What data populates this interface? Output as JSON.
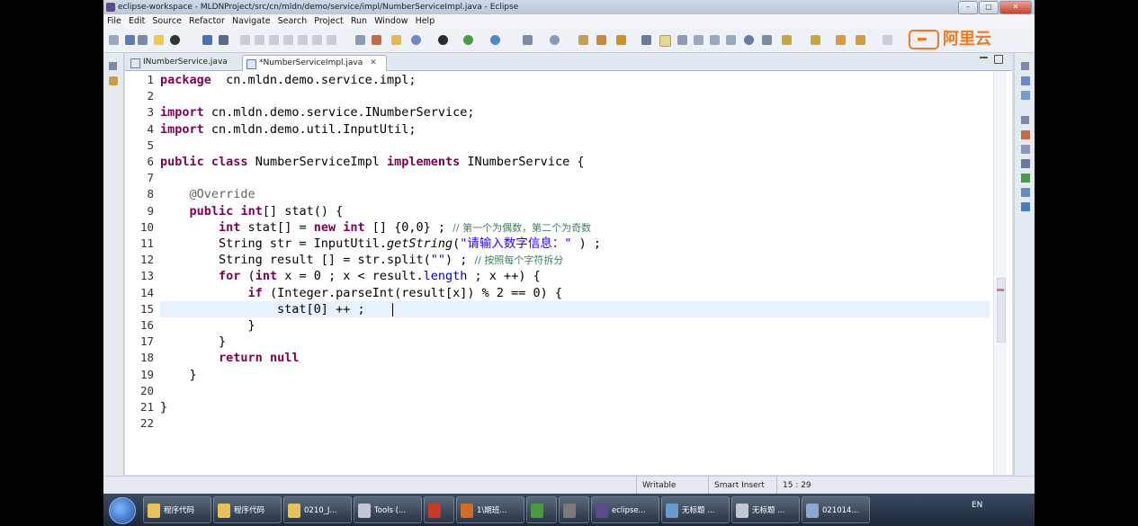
{
  "window": {
    "title": "eclipse-workspace - MLDNProject/src/cn/mldn/demo/service/impl/NumberServiceImpl.java - Eclipse",
    "min": "–",
    "max": "□",
    "close": "✕"
  },
  "menu": [
    "File",
    "Edit",
    "Source",
    "Refactor",
    "Navigate",
    "Search",
    "Project",
    "Run",
    "Window",
    "Help"
  ],
  "logo": {
    "text": "阿里云",
    "accent": "#f07a1f"
  },
  "tabs": [
    {
      "label": "INumberService.java",
      "active": false
    },
    {
      "label": "*NumberServiceImpl.java",
      "active": true
    }
  ],
  "editor": {
    "current_line": 15,
    "lines": [
      {
        "n": "1",
        "segs": [
          [
            "kw",
            "package"
          ],
          [
            "",
            "  cn.mldn.demo.service.impl;"
          ]
        ]
      },
      {
        "n": "2",
        "segs": []
      },
      {
        "n": "3",
        "segs": [
          [
            "kw",
            "import"
          ],
          [
            "",
            " cn.mldn.demo.service.INumberService;"
          ]
        ]
      },
      {
        "n": "4",
        "segs": [
          [
            "kw",
            "import"
          ],
          [
            "",
            " cn.mldn.demo.util.InputUtil;"
          ]
        ]
      },
      {
        "n": "5",
        "segs": []
      },
      {
        "n": "6",
        "segs": [
          [
            "kw",
            "public"
          ],
          [
            "",
            " "
          ],
          [
            "kw",
            "class"
          ],
          [
            "",
            " NumberServiceImpl "
          ],
          [
            "kw",
            "implements"
          ],
          [
            "",
            " INumberService {"
          ]
        ]
      },
      {
        "n": "7",
        "segs": []
      },
      {
        "n": "8",
        "segs": [
          [
            "",
            "    "
          ],
          [
            "ann",
            "@Override"
          ]
        ]
      },
      {
        "n": "9",
        "segs": [
          [
            "",
            "    "
          ],
          [
            "kw",
            "public"
          ],
          [
            "",
            " "
          ],
          [
            "kw",
            "int"
          ],
          [
            "",
            "[] stat() {"
          ]
        ]
      },
      {
        "n": "10",
        "segs": [
          [
            "",
            "        "
          ],
          [
            "kw",
            "int"
          ],
          [
            "",
            " stat[] = "
          ],
          [
            "kw",
            "new"
          ],
          [
            "",
            " "
          ],
          [
            "kw",
            "int"
          ],
          [
            "",
            " [] {0,0} ; "
          ],
          [
            "cm",
            "// 第一个为偶数，第二个为奇数"
          ]
        ]
      },
      {
        "n": "11",
        "segs": [
          [
            "",
            "        String str = InputUtil."
          ],
          [
            "it",
            "getString"
          ],
          [
            "",
            "("
          ],
          [
            "str",
            "\"请输入数字信息：\""
          ],
          [
            "",
            " ) ;"
          ]
        ]
      },
      {
        "n": "12",
        "segs": [
          [
            "",
            "        String result [] = str.split("
          ],
          [
            "str",
            "\"\""
          ],
          [
            "",
            ") ; "
          ],
          [
            "cm",
            "// 按照每个字符拆分"
          ]
        ]
      },
      {
        "n": "13",
        "segs": [
          [
            "",
            "        "
          ],
          [
            "kw",
            "for"
          ],
          [
            "",
            " ("
          ],
          [
            "kw",
            "int"
          ],
          [
            "",
            " x = 0 ; x < result."
          ],
          [
            "fld",
            "length"
          ],
          [
            "",
            " ; x ++) {"
          ]
        ]
      },
      {
        "n": "14",
        "segs": [
          [
            "",
            "            "
          ],
          [
            "kw",
            "if"
          ],
          [
            "",
            " (Integer.parseInt(result[x]) % 2 == 0) {"
          ]
        ]
      },
      {
        "n": "15",
        "segs": [
          [
            "",
            "                stat[0] ++ ;"
          ]
        ]
      },
      {
        "n": "16",
        "segs": [
          [
            "",
            "            }"
          ]
        ]
      },
      {
        "n": "17",
        "segs": [
          [
            "",
            "        }"
          ]
        ]
      },
      {
        "n": "18",
        "segs": [
          [
            "",
            "        "
          ],
          [
            "kw",
            "return"
          ],
          [
            "",
            " "
          ],
          [
            "kw",
            "null"
          ],
          [
            ";"
          ]
        ]
      },
      {
        "n": "19",
        "segs": [
          [
            "",
            "    }"
          ]
        ]
      },
      {
        "n": "20",
        "segs": []
      },
      {
        "n": "21",
        "segs": [
          [
            "",
            "}"
          ]
        ]
      },
      {
        "n": "22",
        "segs": []
      }
    ]
  },
  "status": {
    "writable": "Writable",
    "insert_mode": "Smart Insert",
    "position": "15 : 29"
  },
  "taskbar": {
    "items": [
      {
        "label": "程序代码",
        "icon": "folder-icon",
        "color": "#e8c25a"
      },
      {
        "label": "程序代码",
        "icon": "folder-icon",
        "color": "#e8c25a"
      },
      {
        "label": "0210_J...",
        "icon": "folder-icon",
        "color": "#e8c25a"
      },
      {
        "label": "Tools (...",
        "icon": "drive-icon",
        "color": "#bfc7d2"
      },
      {
        "label": "",
        "icon": "app-icon",
        "color": "#c83a2a"
      },
      {
        "label": "1\\期班...",
        "icon": "slides-icon",
        "color": "#d26a2a"
      },
      {
        "label": "",
        "icon": "chrome-icon",
        "color": "#4a9a3a"
      },
      {
        "label": "",
        "icon": "tool-icon",
        "color": "#7a7a7a"
      },
      {
        "label": "eclipse...",
        "icon": "eclipse-icon",
        "color": "#5b4b8a"
      },
      {
        "label": "无标题 ...",
        "icon": "notebook-icon",
        "color": "#6a9ad2"
      },
      {
        "label": "无标题 ...",
        "icon": "paint-icon",
        "color": "#c0c8d2"
      },
      {
        "label": "021014...",
        "icon": "window-icon",
        "color": "#8aa8d0"
      }
    ],
    "tray": "EN"
  }
}
